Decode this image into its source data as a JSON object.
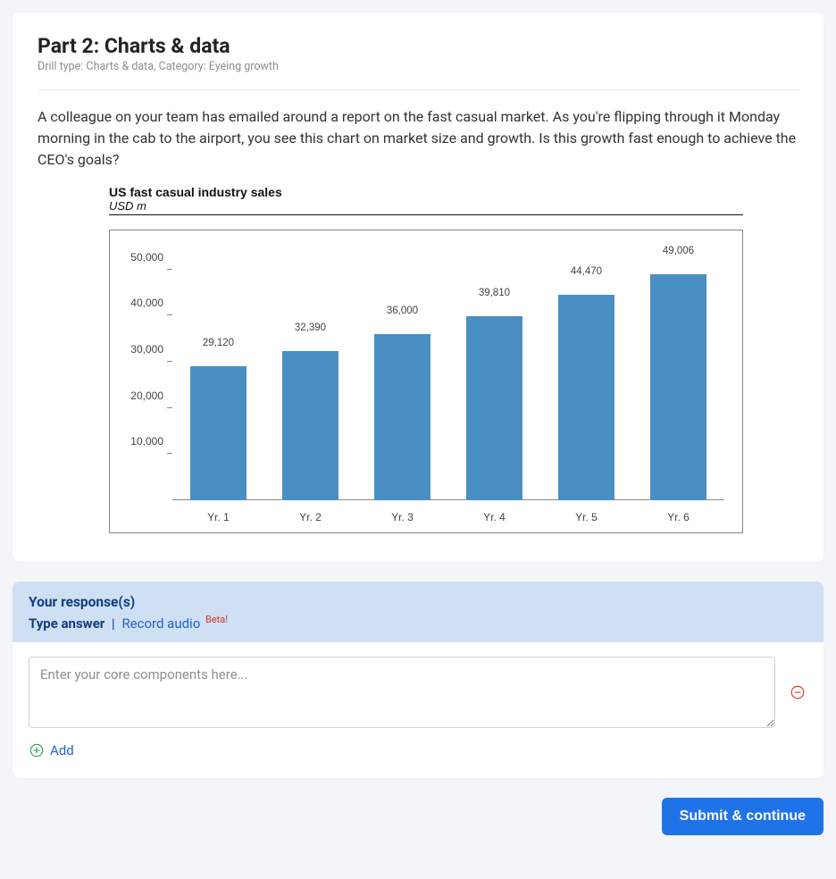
{
  "header": {
    "title": "Part 2: Charts & data",
    "meta": "Drill type: Charts & data, Category: Eyeing growth"
  },
  "prompt": "A colleague on your team has emailed around a report on the fast casual market. As you're flipping through it Monday morning in the cab to the airport, you see this chart on market size and growth. Is this growth fast enough to achieve the CEO's goals?",
  "chart": {
    "title": "US fast casual industry sales",
    "subtitle": "USD m"
  },
  "chart_data": {
    "type": "bar",
    "title": "US fast casual industry sales",
    "subtitle": "USD m",
    "categories": [
      "Yr. 1",
      "Yr. 2",
      "Yr. 3",
      "Yr. 4",
      "Yr. 5",
      "Yr. 6"
    ],
    "values": [
      29120,
      32390,
      36000,
      39810,
      44470,
      49006
    ],
    "value_labels": [
      "29,120",
      "32,390",
      "36,000",
      "39,810",
      "44,470",
      "49,006"
    ],
    "yticks": [
      10000,
      20000,
      30000,
      40000,
      50000
    ],
    "ytick_labels": [
      "10,000",
      "20,000",
      "30,000",
      "40,000",
      "50,000"
    ],
    "ylim": [
      0,
      55000
    ],
    "xlabel": "",
    "ylabel": ""
  },
  "response": {
    "heading": "Your response(s)",
    "mode_type": "Type answer",
    "mode_sep": "|",
    "mode_record": "Record audio",
    "beta": "Beta!",
    "placeholder": "Enter your core components here...",
    "add_label": "Add"
  },
  "actions": {
    "submit": "Submit & continue"
  }
}
